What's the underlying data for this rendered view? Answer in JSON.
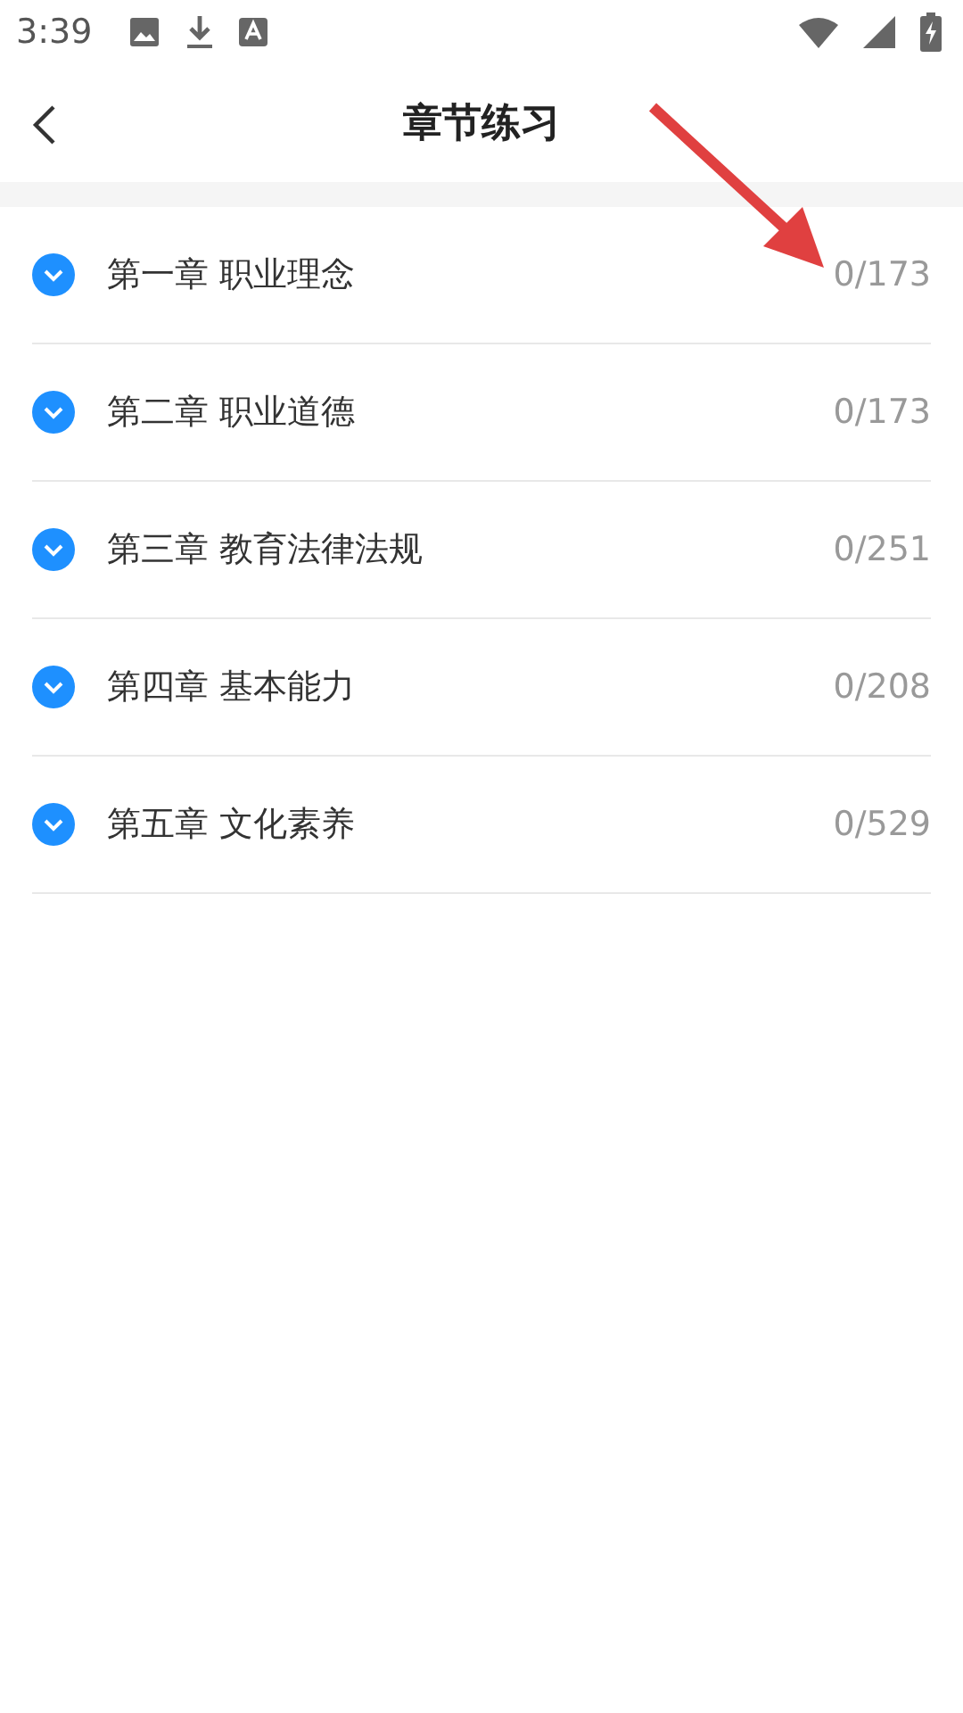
{
  "status_bar": {
    "time": "3:39"
  },
  "header": {
    "title": "章节练习"
  },
  "chapters": [
    {
      "name": "第一章 职业理念",
      "progress": "0/173"
    },
    {
      "name": "第二章 职业道德",
      "progress": "0/173"
    },
    {
      "name": "第三章 教育法律法规",
      "progress": "0/251"
    },
    {
      "name": "第四章 基本能力",
      "progress": "0/208"
    },
    {
      "name": "第五章 文化素养",
      "progress": "0/529"
    }
  ]
}
